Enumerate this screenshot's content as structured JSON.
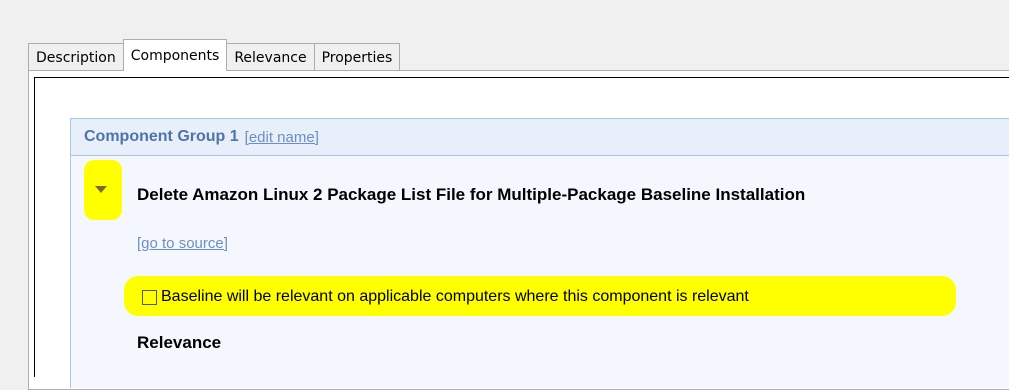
{
  "tabs": [
    {
      "label": "Description",
      "active": false
    },
    {
      "label": "Components",
      "active": true
    },
    {
      "label": "Relevance",
      "active": false
    },
    {
      "label": "Properties",
      "active": false
    }
  ],
  "component_group": {
    "title": "Component Group 1",
    "edit_name_link": "[edit name]",
    "component": {
      "name": "Delete Amazon Linux 2 Package List File for Multiple-Package Baseline Installation",
      "go_to_source_link": "[go to source]",
      "checkbox": {
        "label": "Baseline will be relevant on applicable computers where this component is relevant",
        "checked": false
      },
      "relevance_heading": "Relevance"
    }
  },
  "colors": {
    "highlight": "#ffff00",
    "group_title": "#4f74a8",
    "link": "#6b8fc4"
  }
}
